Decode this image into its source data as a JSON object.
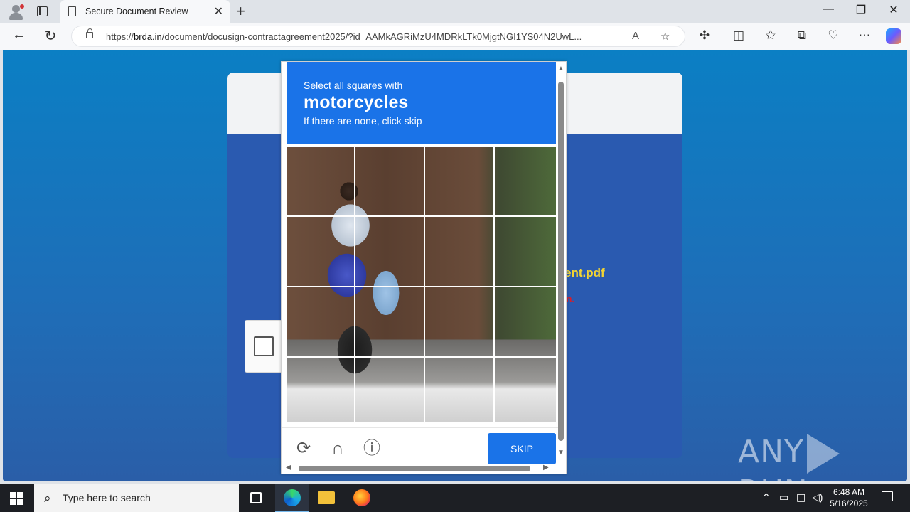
{
  "browser": {
    "tab_title": "Secure Document Review",
    "tab_close": "✕",
    "new_tab": "+",
    "url_prefix": "https://",
    "url_host": "brda.in",
    "url_rest": "/document/docusign-contractagreement2025/?id=AAMkAGRiMzU4MDRkLTk0MjgtNGI1YS04N2UwL...",
    "window_controls": {
      "minimize": "—",
      "restore": "❐",
      "close": "✕"
    }
  },
  "page": {
    "filename_partial": "ent.pdf",
    "red_partial": "n."
  },
  "captcha": {
    "prompt_line1": "Select all squares with",
    "prompt_target": "motorcycles",
    "prompt_line3": "If there are none, click skip",
    "skip_label": "SKIP",
    "icons": [
      "refresh-icon",
      "headphones-icon",
      "info-icon"
    ]
  },
  "watermark": {
    "left": "ANY",
    "right": "RUN"
  },
  "taskbar": {
    "search_placeholder": "Type here to search",
    "time": "6:48 AM",
    "date": "5/16/2025"
  }
}
